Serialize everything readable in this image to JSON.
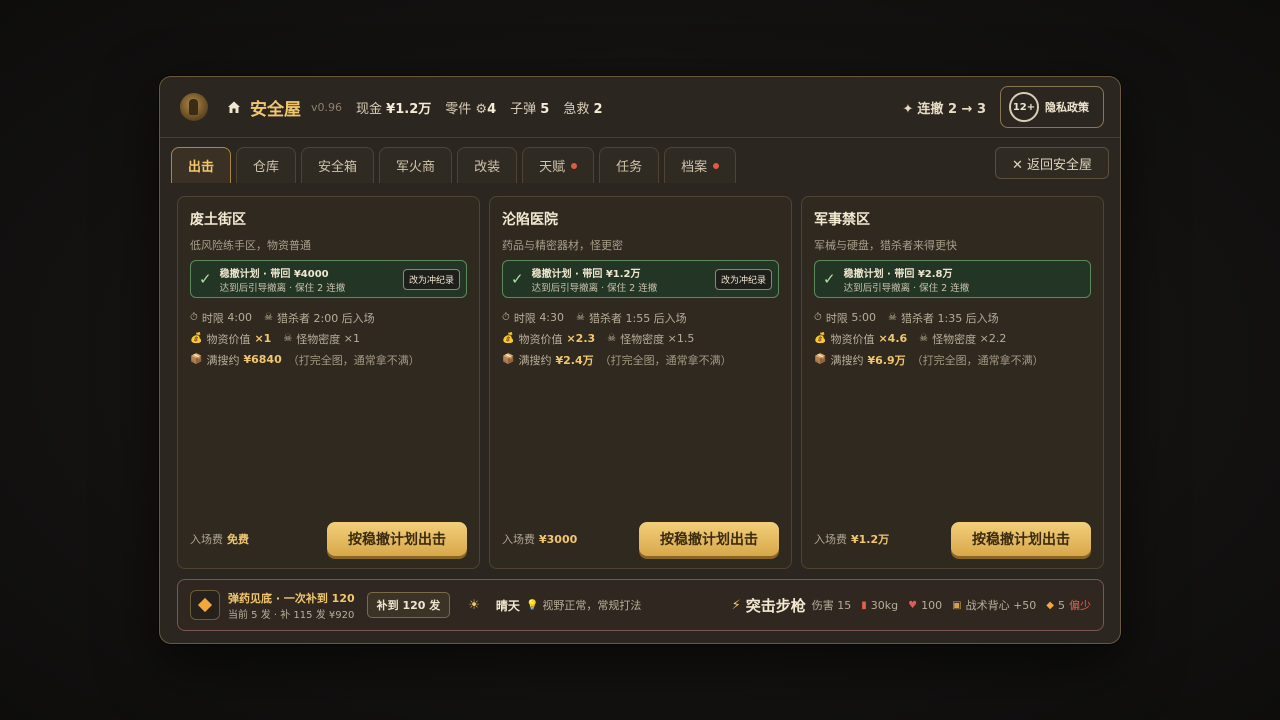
{
  "header": {
    "title": "安全屋",
    "version": "v0.96",
    "cash_label": "现金",
    "cash_value": "¥1.2万",
    "parts_label": "零件",
    "parts_value": "4",
    "ammo_label": "子弹",
    "ammo_value": "5",
    "medkit_label": "急救",
    "medkit_value": "2",
    "streak_label": "连撤",
    "streak_value": "2 → 3",
    "age_rating": "12+",
    "privacy_label": "隐私政策"
  },
  "tabs": [
    {
      "label": "出击",
      "active": true,
      "dot": false
    },
    {
      "label": "仓库",
      "active": false,
      "dot": false
    },
    {
      "label": "安全箱",
      "active": false,
      "dot": false
    },
    {
      "label": "军火商",
      "active": false,
      "dot": false
    },
    {
      "label": "改装",
      "active": false,
      "dot": false
    },
    {
      "label": "天赋",
      "active": false,
      "dot": true
    },
    {
      "label": "任务",
      "active": false,
      "dot": false
    },
    {
      "label": "档案",
      "active": false,
      "dot": true
    }
  ],
  "back_button": "✕ 返回安全屋",
  "maps": [
    {
      "name": "废土街区",
      "desc": "低风险练手区，物资普通",
      "plan_title": "稳撤计划 · 带回 ¥4000",
      "plan_detail": "达到后引导撤离 · 保住 2 连撤",
      "plan_button": "改为冲纪录",
      "time_label": "时限",
      "time_value": "4:00",
      "hunter_label": "猎杀者",
      "hunter_value": "2:00 后入场",
      "loot_label": "物资价值",
      "loot_value": "×1",
      "monster_label": "怪物密度",
      "monster_value": "×1",
      "full_label": "满搜约",
      "full_value": "¥6840",
      "full_note": "（打完全图，通常拿不满）",
      "fee_label": "入场费",
      "fee_value": "免费",
      "go_button": "按稳撤计划出击"
    },
    {
      "name": "沦陷医院",
      "desc": "药品与精密器材，怪更密",
      "plan_title": "稳撤计划 · 带回 ¥1.2万",
      "plan_detail": "达到后引导撤离 · 保住 2 连撤",
      "plan_button": "改为冲纪录",
      "time_label": "时限",
      "time_value": "4:30",
      "hunter_label": "猎杀者",
      "hunter_value": "1:55 后入场",
      "loot_label": "物资价值",
      "loot_value": "×2.3",
      "monster_label": "怪物密度",
      "monster_value": "×1.5",
      "full_label": "满搜约",
      "full_value": "¥2.4万",
      "full_note": "（打完全图，通常拿不满）",
      "fee_label": "入场费",
      "fee_value": "¥3000",
      "go_button": "按稳撤计划出击"
    },
    {
      "name": "军事禁区",
      "desc": "军械与硬盘，猎杀者来得更快",
      "plan_title": "稳撤计划 · 带回 ¥2.8万",
      "plan_detail": "达到后引导撤离 · 保住 2 连撤",
      "plan_button": "",
      "time_label": "时限",
      "time_value": "5:00",
      "hunter_label": "猎杀者",
      "hunter_value": "1:35 后入场",
      "loot_label": "物资价值",
      "loot_value": "×4.6",
      "monster_label": "怪物密度",
      "monster_value": "×2.2",
      "full_label": "满搜约",
      "full_value": "¥6.9万",
      "full_note": "（打完全图，通常拿不满）",
      "fee_label": "入场费",
      "fee_value": "¥1.2万",
      "go_button": "按稳撤计划出击"
    }
  ],
  "bottom": {
    "ammo_title": "弹药见底 · 一次补到 120",
    "ammo_detail": "当前 5 发 · 补 115 发 ¥920",
    "refill_button": "补到 120 发",
    "weather": "晴天",
    "weather_desc": "视野正常，常规打法",
    "weapon": "突击步枪",
    "damage": "伤害 15",
    "weight": "30kg",
    "hp": "100",
    "backpack": "战术背心 +50",
    "ammo_count": "5",
    "ammo_low": "偏少"
  },
  "colors": {
    "accent": "#f2c66d",
    "plan_bg": "#233626",
    "alert_red": "#e0624c"
  }
}
